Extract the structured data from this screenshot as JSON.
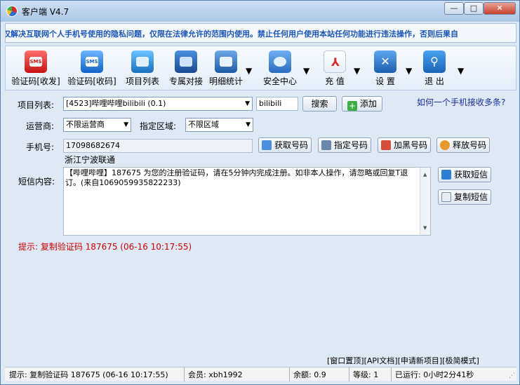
{
  "window": {
    "title": "客户端 V4.7",
    "controls": [
      "—",
      "□",
      "✕"
    ]
  },
  "ticker": {
    "text": "仅解决互联网个人手机号使用的隐私问题，仅限在法律允许的范围内使用。禁止任何用户使用本站任何功能进行违法操作，否则后果自"
  },
  "toolbar": {
    "items": [
      {
        "label": "验证码[收发]",
        "icon": "sms-icon"
      },
      {
        "label": "验证码[收码]",
        "icon": "sms-icon"
      },
      {
        "label": "项目列表",
        "icon": "list-icon"
      },
      {
        "label": "专属对接",
        "icon": "monitor-icon"
      },
      {
        "label": "明细统计",
        "icon": "chart-icon"
      },
      {
        "label": "安全中心",
        "icon": "users-icon"
      },
      {
        "label": "充 值",
        "icon": "pdf-icon"
      },
      {
        "label": "设 置",
        "icon": "tools-icon"
      },
      {
        "label": "退 出",
        "icon": "exit-icon"
      }
    ]
  },
  "form": {
    "project_label": "项目列表:",
    "project_value": "[4523]哔哩哔哩bilibili (0.1)",
    "search_value": "bilibili",
    "search_button": "搜索",
    "add_button": "添加",
    "help_link": "如何一个手机接收多条?",
    "carrier_label": "运营商:",
    "carrier_value": "不限运营商",
    "region_label": "指定区域:",
    "region_value": "不限区域",
    "phone_label": "手机号:",
    "phone_value": "17098682674",
    "location": "浙江宁波联通",
    "get_number": "获取号码",
    "assign_number": "指定号码",
    "blacklist_number": "加黑号码",
    "release_number": "释放号码",
    "sms_label": "短信内容:",
    "sms_text": "【哔哩哔哩】187675 为您的注册验证码，请在5分钟内完成注册。如非本人操作，请忽略或回复T退订。(来自1069059935822233)",
    "get_sms": "获取短信",
    "copy_sms": "复制短信",
    "hint": "提示: 复制验证码 187675 (06-16 10:17:55)"
  },
  "footer_links": [
    "[窗口置顶]",
    "[API文档]",
    "[申请新项目]",
    "[极简模式]"
  ],
  "status": {
    "hint": "提示: 复制验证码 187675 (06-16 10:17:55)",
    "member": "会员: xbh1992",
    "balance": "余额: 0.9",
    "level": "等级: 1",
    "running": "已运行: 0小时2分41秒"
  }
}
